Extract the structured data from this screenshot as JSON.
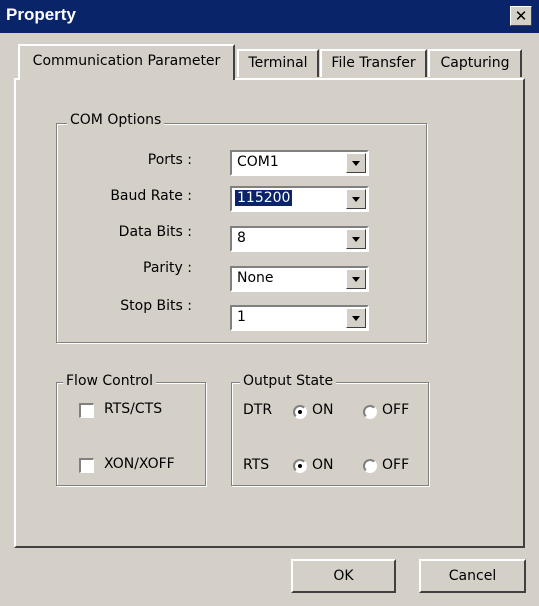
{
  "window": {
    "title": "Property",
    "close_glyph": "✕"
  },
  "tabs": [
    {
      "label": "Communication Parameter",
      "active": true
    },
    {
      "label": "Terminal"
    },
    {
      "label": "File Transfer"
    },
    {
      "label": "Capturing"
    }
  ],
  "com_options": {
    "title": "COM Options",
    "rows": [
      {
        "label": "Ports :",
        "value": "COM1"
      },
      {
        "label": "Baud Rate :",
        "value": "115200"
      },
      {
        "label": "Data Bits :",
        "value": "8"
      },
      {
        "label": "Parity :",
        "value": "None"
      },
      {
        "label": "Stop Bits :",
        "value": "1"
      }
    ]
  },
  "flow_control": {
    "title": "Flow Control",
    "rts_cts": "RTS/CTS",
    "xon_xoff": "XON/XOFF"
  },
  "output_state": {
    "title": "Output State",
    "dtr": {
      "label": "DTR",
      "on": "ON",
      "off": "OFF"
    },
    "rts": {
      "label": "RTS",
      "on": "ON",
      "off": "OFF"
    }
  },
  "buttons": {
    "ok": "OK",
    "cancel": "Cancel"
  }
}
